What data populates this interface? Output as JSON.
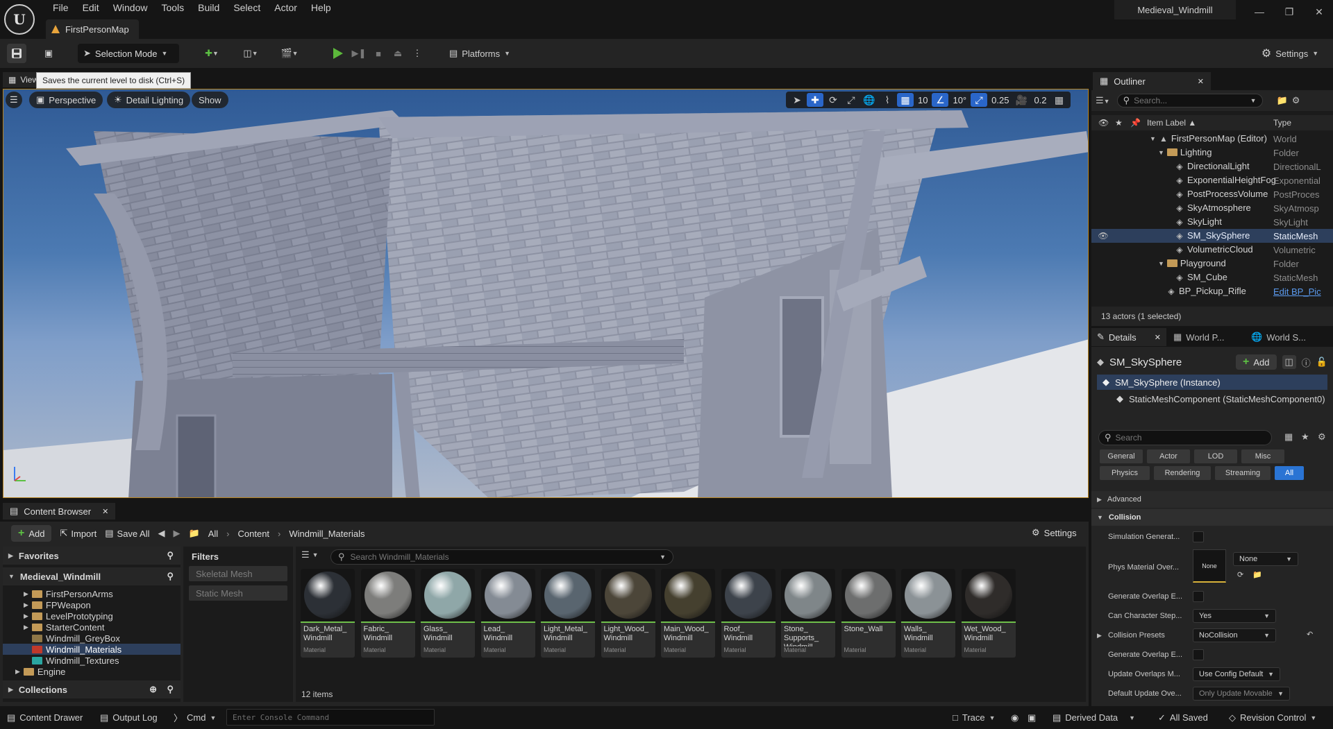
{
  "menu": [
    "File",
    "Edit",
    "Window",
    "Tools",
    "Build",
    "Select",
    "Actor",
    "Help"
  ],
  "project_name": "Medieval_Windmill",
  "level_tab": "FirstPersonMap",
  "toolbar": {
    "selection_mode": "Selection Mode",
    "platforms": "Platforms",
    "settings": "Settings"
  },
  "tooltip": "Saves the current level to disk (Ctrl+S)",
  "viewport": {
    "tab_label": "Viewport 1",
    "perspective": "Perspective",
    "lighting": "Detail Lighting",
    "show": "Show",
    "grid_snap": "10",
    "rot_snap": "10°",
    "scale_snap": "0.25",
    "camera_speed": "0.2"
  },
  "content_browser": {
    "tab": "Content Browser",
    "add": "Add",
    "import": "Import",
    "save_all": "Save All",
    "breadcrumb": [
      "All",
      "Content",
      "Windmill_Materials"
    ],
    "settings": "Settings",
    "favorites": "Favorites",
    "root": "Medieval_Windmill",
    "folders": [
      "FirstPersonArms",
      "FPWeapon",
      "LevelPrototyping",
      "StarterContent",
      "Windmill_GreyBox",
      "Windmill_Materials",
      "Windmill_Textures"
    ],
    "engine": "Engine",
    "collections": "Collections",
    "filters_title": "Filters",
    "filters": [
      "Skeletal Mesh",
      "Static Mesh"
    ],
    "search_placeholder": "Search Windmill_Materials",
    "item_count": "12 items",
    "assets": [
      {
        "name": "Dark_Metal_ Windmill",
        "type": "Material",
        "color": "#2c3036"
      },
      {
        "name": "Fabric_ Windmill",
        "type": "Material",
        "color": "#7d7d7b"
      },
      {
        "name": "Glass_ Windmill",
        "type": "Material",
        "color": "#8fa7a8"
      },
      {
        "name": "Lead_ Windmill",
        "type": "Material",
        "color": "#848b94"
      },
      {
        "name": "Light_Metal_ Windmill",
        "type": "Material",
        "color": "#59656f"
      },
      {
        "name": "Light_Wood_ Windmill",
        "type": "Material",
        "color": "#4c4639"
      },
      {
        "name": "Main_Wood_ Windmill",
        "type": "Material",
        "color": "#45402f"
      },
      {
        "name": "Roof_ Windmill",
        "type": "Material",
        "color": "#3d434b"
      },
      {
        "name": "Stone_ Supports_ Windmill",
        "type": "Material",
        "color": "#7f8689"
      },
      {
        "name": "Stone_Wall",
        "type": "Material",
        "color": "#6d6e6e"
      },
      {
        "name": "Walls_ Windmill",
        "type": "Material",
        "color": "#8b9296"
      },
      {
        "name": "Wet_Wood_ Windmill",
        "type": "Material",
        "color": "#2f2c2a"
      }
    ]
  },
  "outliner": {
    "tab": "Outliner",
    "search_placeholder": "Search...",
    "col_label": "Item Label ▲",
    "col_type": "Type",
    "rows": [
      {
        "label": "FirstPersonMap (Editor)",
        "type": "World",
        "indent": 0
      },
      {
        "label": "Lighting",
        "type": "Folder",
        "indent": 1
      },
      {
        "label": "DirectionalLight",
        "type": "DirectionalL",
        "indent": 2
      },
      {
        "label": "ExponentialHeightFog",
        "type": "Exponential",
        "indent": 2
      },
      {
        "label": "PostProcessVolume",
        "type": "PostProces",
        "indent": 2
      },
      {
        "label": "SkyAtmosphere",
        "type": "SkyAtmosp",
        "indent": 2
      },
      {
        "label": "SkyLight",
        "type": "SkyLight",
        "indent": 2
      },
      {
        "label": "SM_SkySphere",
        "type": "StaticMesh",
        "indent": 2
      },
      {
        "label": "VolumetricCloud",
        "type": "Volumetric",
        "indent": 2
      },
      {
        "label": "Playground",
        "type": "Folder",
        "indent": 1
      },
      {
        "label": "SM_Cube",
        "type": "StaticMesh",
        "indent": 2
      },
      {
        "label": "BP_Pickup_Rifle",
        "type": "Edit BP_Pic",
        "indent": 1
      }
    ],
    "status": "13 actors (1 selected)"
  },
  "details": {
    "tabs": [
      "Details",
      "World P...",
      "World S..."
    ],
    "actor": "SM_SkySphere",
    "add": "Add",
    "instance": "SM_SkySphere (Instance)",
    "component": "StaticMeshComponent (StaticMeshComponent0)",
    "search_placeholder": "Search",
    "cats_row1": [
      "General",
      "Actor",
      "LOD",
      "Misc"
    ],
    "cats_row2": [
      "Physics",
      "Rendering",
      "Streaming",
      "All"
    ],
    "advanced": "Advanced",
    "collision": "Collision",
    "props": {
      "sim_gen": "Simulation Generat...",
      "phys_mat": "Phys Material Over...",
      "phys_mat_val": "None",
      "thumb_none": "None",
      "gen_overlap": "Generate Overlap E...",
      "can_step": "Can Character Step...",
      "can_step_val": "Yes",
      "presets": "Collision Presets",
      "presets_val": "NoCollision",
      "gen_overlap2": "Generate Overlap E...",
      "update_overlaps": "Update Overlaps M...",
      "update_overlaps_val": "Use Config Default",
      "default_update": "Default Update Ove...",
      "default_update_val": "Only Update Movable"
    }
  },
  "statusbar": {
    "content_drawer": "Content Drawer",
    "output_log": "Output Log",
    "cmd": "Cmd",
    "console_placeholder": "Enter Console Command",
    "trace": "Trace",
    "derived": "Derived Data",
    "saved": "All Saved",
    "revision": "Revision Control"
  }
}
